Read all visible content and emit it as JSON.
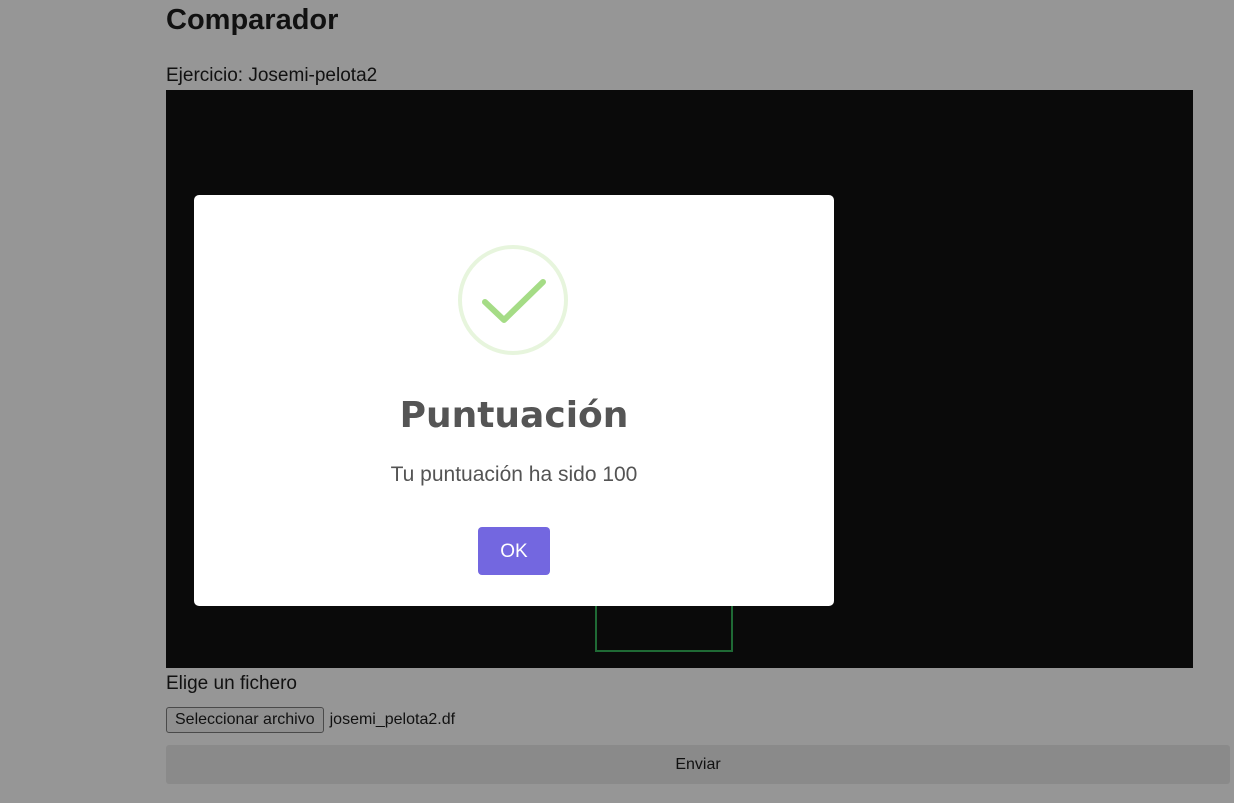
{
  "page": {
    "title": "Comparador",
    "exercise_label": "Ejercicio: Josemi-pelota2"
  },
  "file_input": {
    "label": "Elige un fichero",
    "button_label": "Seleccionar archivo",
    "selected_file": "josemi_pelota2.df"
  },
  "submit": {
    "label": "Enviar"
  },
  "modal": {
    "icon": "checkmark-success-icon",
    "title": "Puntuación",
    "message": "Tu puntuación ha sido 100",
    "confirm_label": "OK"
  },
  "colors": {
    "background": "#969696",
    "canvas": "#0a0a0a",
    "accent": "#7367e0",
    "success": "#a5dc86"
  }
}
